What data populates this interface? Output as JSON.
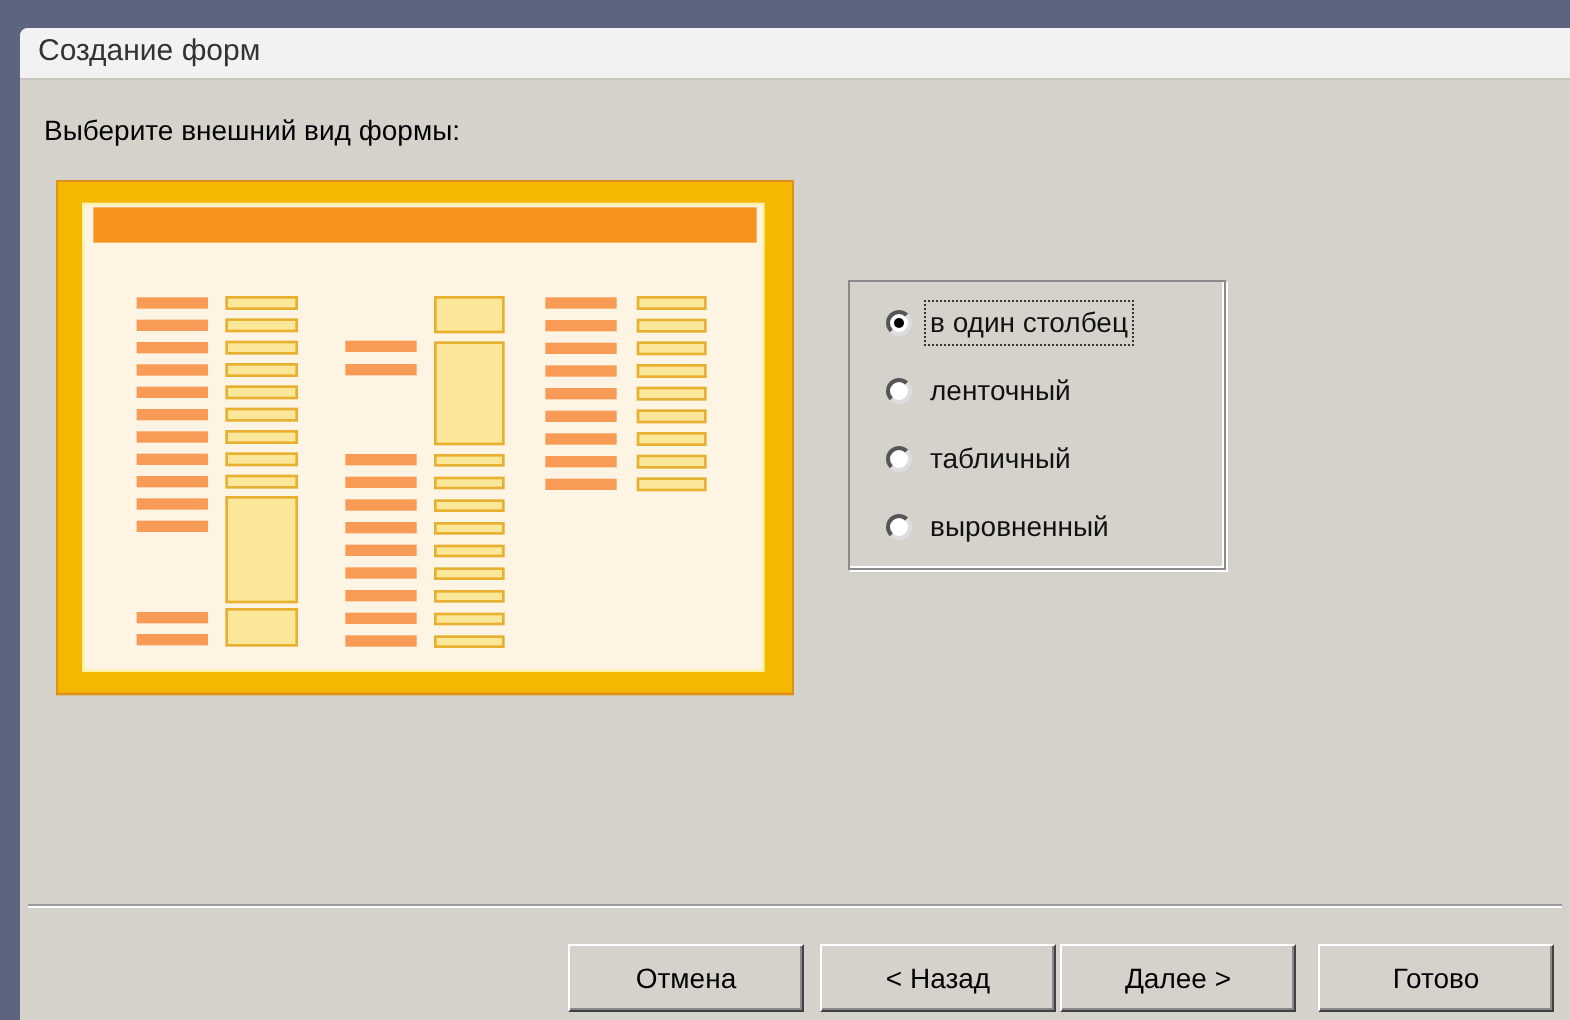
{
  "window": {
    "title": "Создание форм"
  },
  "prompt": "Выберите внешний вид формы:",
  "layouts": [
    {
      "label": "в один столбец",
      "selected": true,
      "focused": true
    },
    {
      "label": "ленточный",
      "selected": false,
      "focused": false
    },
    {
      "label": "табличный",
      "selected": false,
      "focused": false
    },
    {
      "label": "выровненный",
      "selected": false,
      "focused": false
    }
  ],
  "buttons": [
    {
      "label": "Отмена"
    },
    {
      "label": "< Назад"
    },
    {
      "label": "Далее >"
    },
    {
      "label": "Готово"
    }
  ]
}
